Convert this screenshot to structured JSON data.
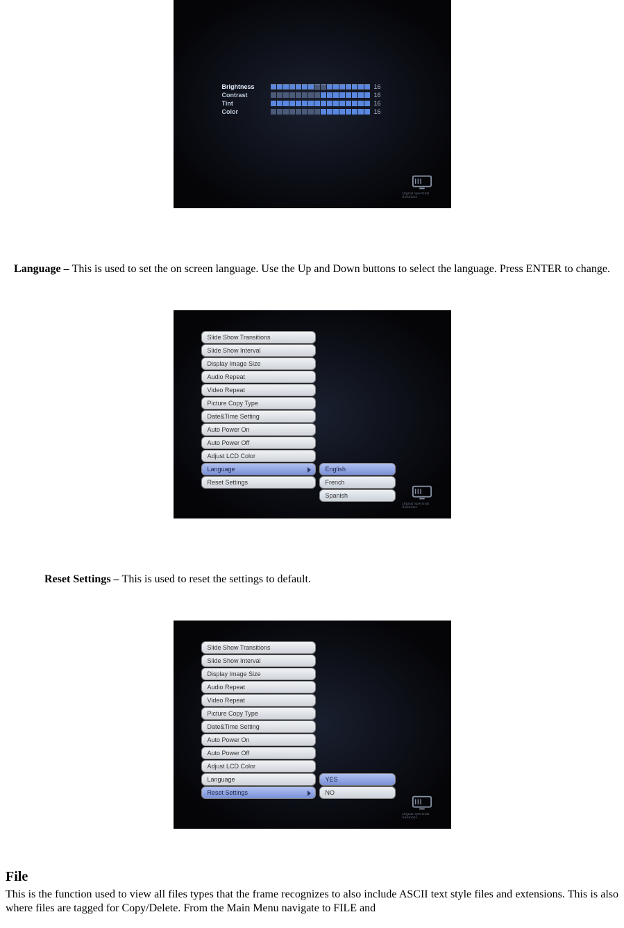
{
  "brand": "Digital Spectrum Solutions",
  "photo1": {
    "sliders": [
      {
        "label": "Brightness",
        "value": 16,
        "segments": 16,
        "filled_first": 7,
        "filled_last": 7,
        "active": true
      },
      {
        "label": "Contrast",
        "value": 16,
        "segments": 16,
        "filled_first": 0,
        "filled_last": 8,
        "active": false
      },
      {
        "label": "Tint",
        "value": 16,
        "segments": 16,
        "filled_first": 8,
        "filled_last": 8,
        "active": false
      },
      {
        "label": "Color",
        "value": 16,
        "segments": 16,
        "filled_first": 0,
        "filled_last": 8,
        "active": false
      }
    ]
  },
  "section_language": {
    "label": "Language – ",
    "text": "This is used to set the on screen language. Use the Up and Down buttons to select the language. Press ENTER to change."
  },
  "photo2": {
    "menu": [
      "Slide Show Transitions",
      "Slide Show Interval",
      "Display Image Size",
      "Audio Repeat",
      "Video Repeat",
      "Picture Copy Type",
      "Date&Time Setting",
      "Auto Power On",
      "Auto Power Off",
      "Adjust LCD Color",
      "Language",
      "Reset Settings"
    ],
    "selected_index": 10,
    "submenu": [
      "English",
      "French",
      "Spanish"
    ],
    "submenu_selected": 0
  },
  "section_reset": {
    "label": "Reset Settings – ",
    "text": "This is used to reset the settings to default."
  },
  "photo3": {
    "menu": [
      "Slide Show Transitions",
      "Slide Show Interval",
      "Display Image Size",
      "Audio Repeat",
      "Video Repeat",
      "Picture Copy Type",
      "Date&Time Setting",
      "Auto Power On",
      "Auto Power Off",
      "Adjust LCD Color",
      "Language",
      "Reset Settings"
    ],
    "selected_index": 11,
    "submenu": [
      "YES",
      "NO"
    ],
    "submenu_selected": 0
  },
  "section_file": {
    "heading": "File",
    "text": "This is the function used to view all files types that the frame recognizes to also include ASCII text style files and extensions. This is also where files are tagged for Copy/Delete. From the Main Menu navigate to FILE and"
  }
}
